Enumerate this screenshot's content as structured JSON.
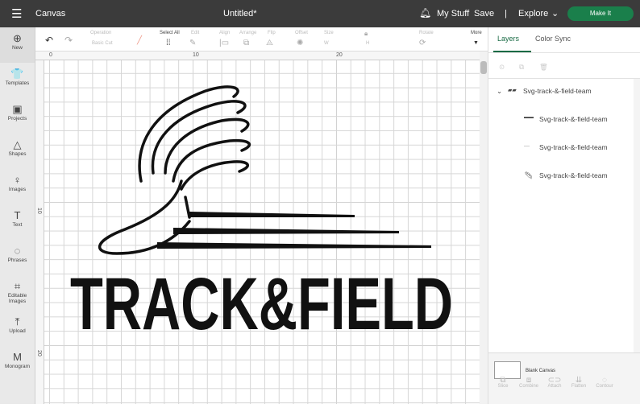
{
  "topbar": {
    "menu_icon": "hamburger-icon",
    "app": "Canvas",
    "title": "Untitled*",
    "bell_icon": "bell-icon",
    "mystuff": "My Stuff",
    "save": "Save",
    "separator": "|",
    "explore": "Explore",
    "make": "Make It"
  },
  "sidebar": [
    {
      "icon": "⊕",
      "label": "New"
    },
    {
      "icon": "👕",
      "label": "Templates"
    },
    {
      "icon": "▣",
      "label": "Projects"
    },
    {
      "icon": "△",
      "label": "Shapes"
    },
    {
      "icon": "♀",
      "label": "Images"
    },
    {
      "icon": "T",
      "label": "Text"
    },
    {
      "icon": "◌",
      "label": "Phrases"
    },
    {
      "icon": "⌗",
      "label": "Editable Images"
    },
    {
      "icon": "⤒",
      "label": "Upload"
    },
    {
      "icon": "M",
      "label": "Monogram"
    }
  ],
  "toolbar": {
    "operation": "Operation",
    "operation_value": "Basic Cut",
    "select_all": "Select All",
    "edit": "Edit",
    "align": "Align",
    "arrange": "Arrange",
    "flip": "Flip",
    "offset": "Offset",
    "size": "Size",
    "w": "W",
    "h": "H",
    "rotate": "Rotate",
    "more": "More"
  },
  "ruler": {
    "h": [
      "0",
      "10",
      "20"
    ],
    "v": [
      "10",
      "20"
    ]
  },
  "artwork": {
    "text": "TRACK&FIELD"
  },
  "panel": {
    "tabs": [
      "Layers",
      "Color Sync"
    ],
    "group": "Svg-track-&-field-team",
    "layers": [
      "Svg-track-&-field-team",
      "Svg-track-&-field-team",
      "Svg-track-&-field-team"
    ],
    "blank": "Blank Canvas",
    "actions": [
      {
        "icon": "⧉",
        "label": "Slice"
      },
      {
        "icon": "⧈",
        "label": "Combine"
      },
      {
        "icon": "⊂⊃",
        "label": "Attach"
      },
      {
        "icon": "⇊",
        "label": "Flatten"
      },
      {
        "icon": "◌",
        "label": "Contour"
      }
    ]
  },
  "colors": {
    "topbar": "#3b3b3b",
    "accent": "#1a7f4b"
  }
}
